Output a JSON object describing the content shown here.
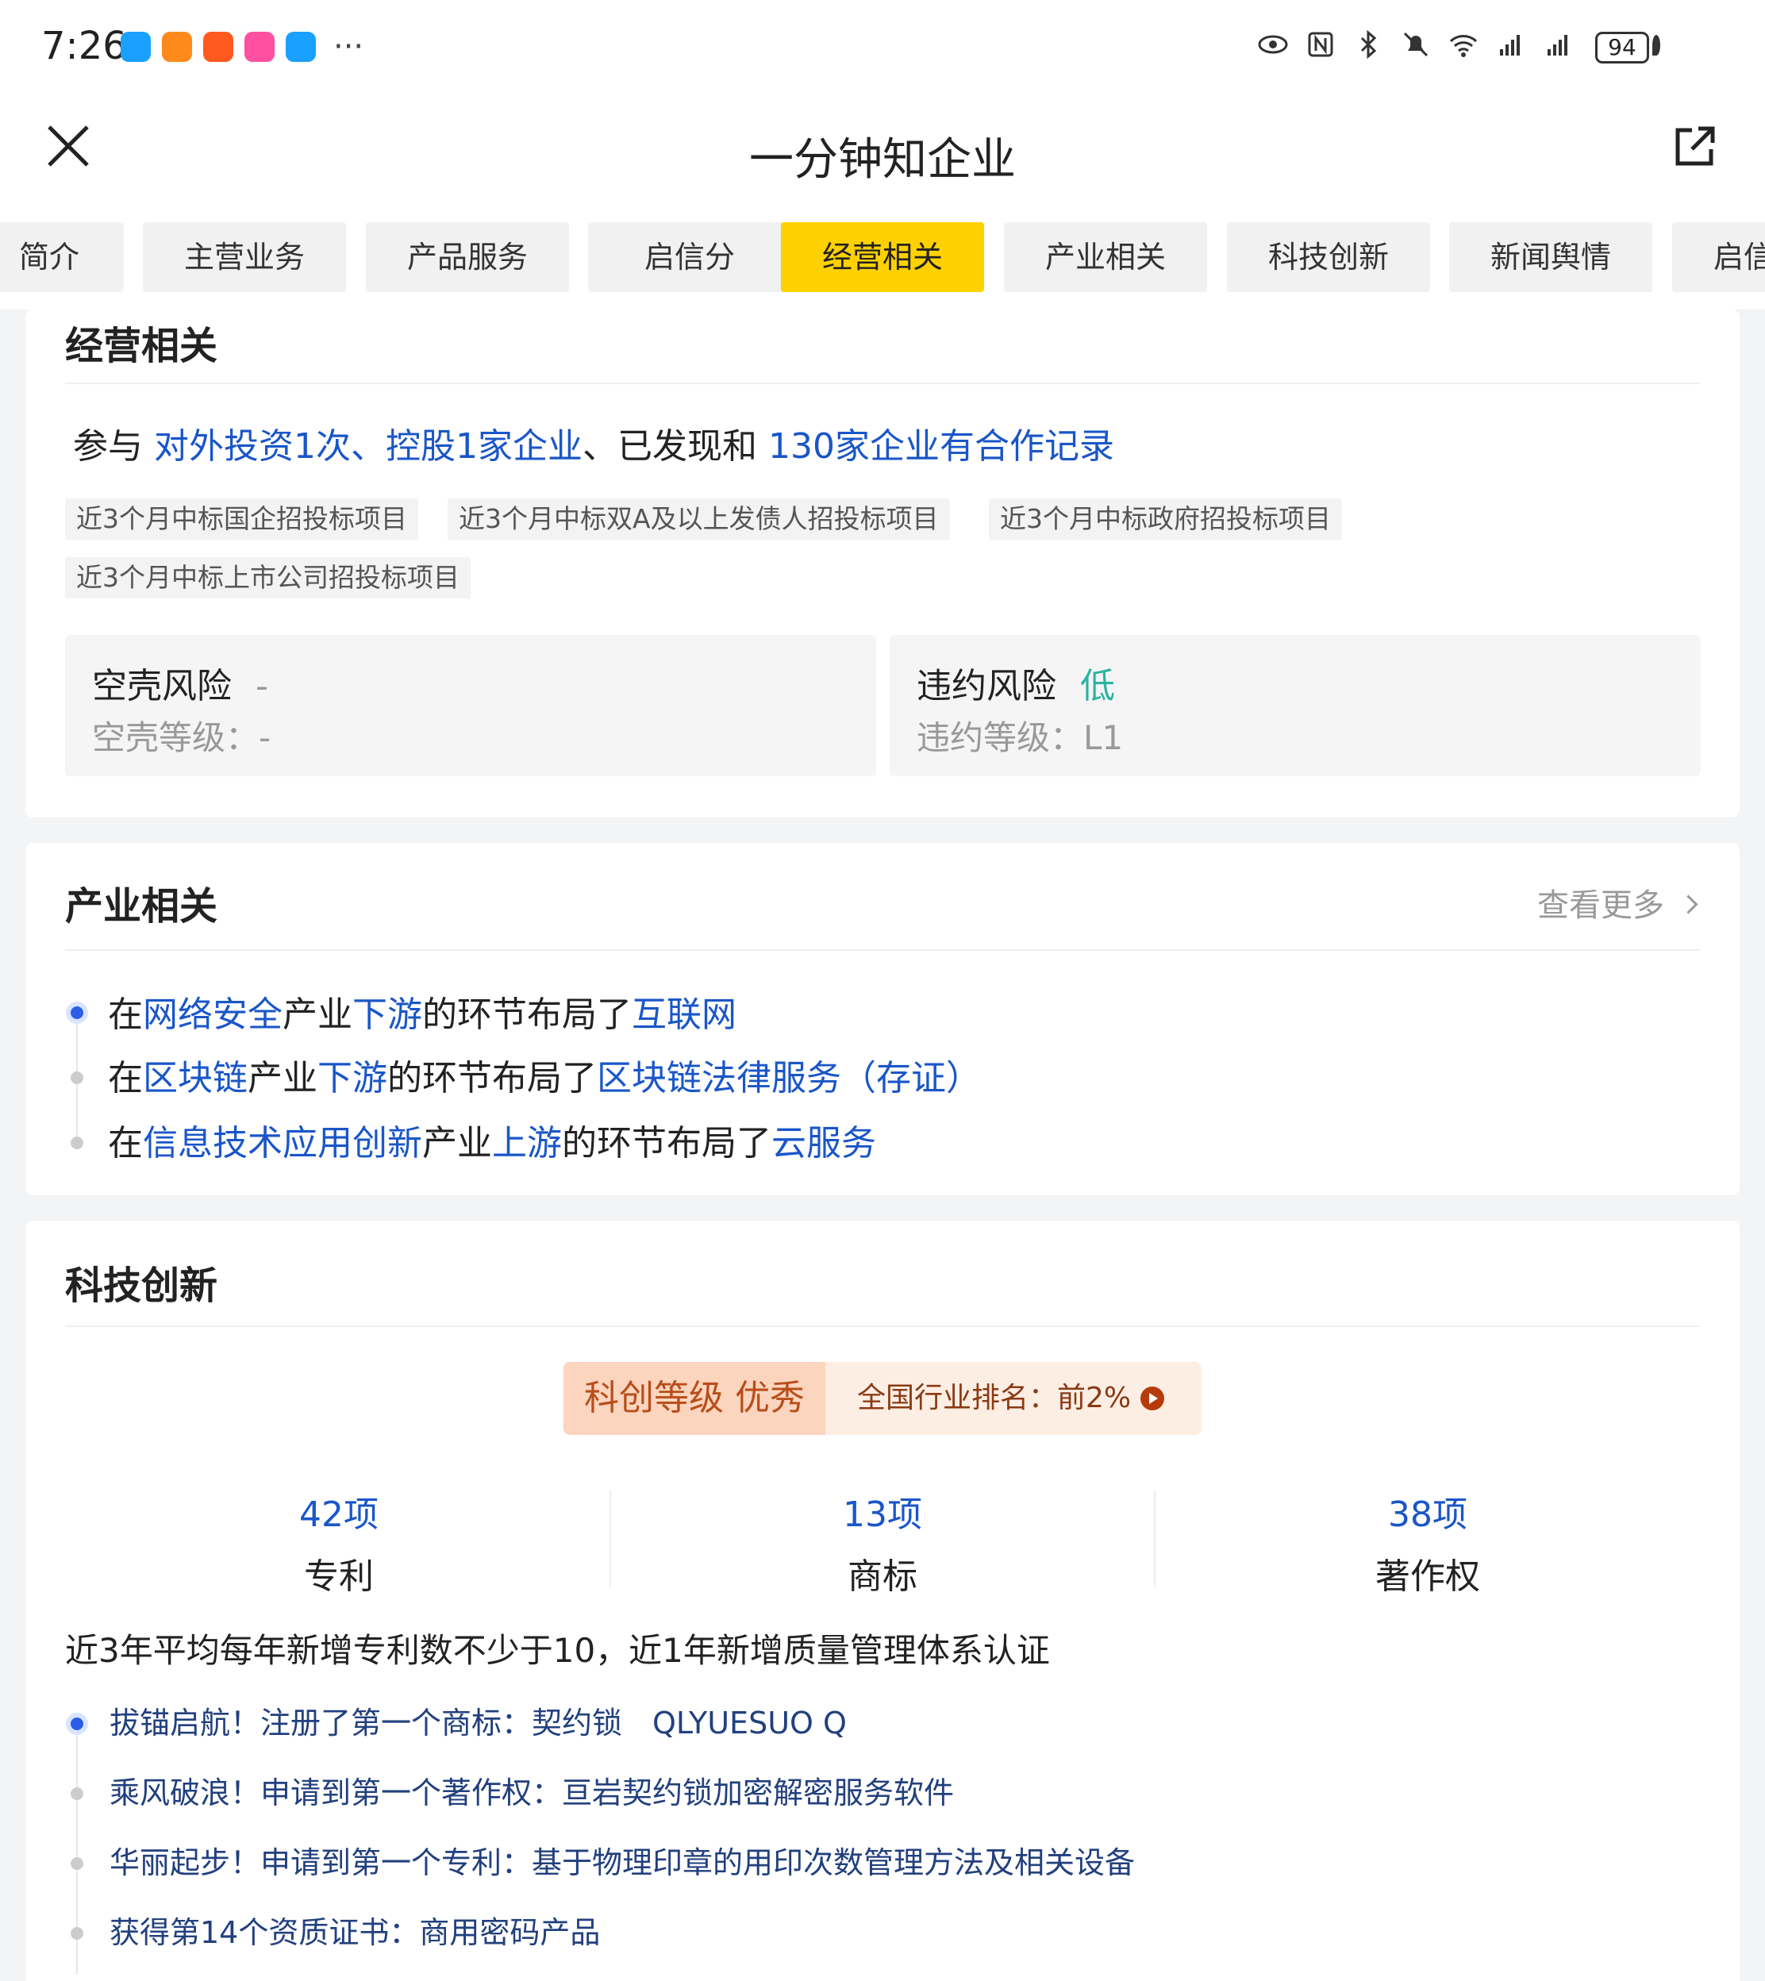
{
  "status_bar": {
    "time": "7:26",
    "more": "···",
    "battery": "94",
    "apps": [
      {
        "name": "cloud-app-icon",
        "color": "#1aa0ff"
      },
      {
        "name": "game-app-icon",
        "color": "#ff8a1c"
      },
      {
        "name": "taobao-app-icon",
        "color": "#ff5a1f"
      },
      {
        "name": "lala-app-icon",
        "color": "#ff4fa0"
      },
      {
        "name": "cloud-app-icon-2",
        "color": "#1aa0ff"
      }
    ]
  },
  "header": {
    "title": "一分钟知企业"
  },
  "tabs": [
    {
      "label": "简介"
    },
    {
      "label": "主营业务"
    },
    {
      "label": "产品服务"
    },
    {
      "label": "启信分"
    },
    {
      "label": "经营相关"
    },
    {
      "label": "产业相关"
    },
    {
      "label": "科技创新"
    },
    {
      "label": "新闻舆情"
    },
    {
      "label": "启信"
    }
  ],
  "active_tab": "经营相关",
  "operations": {
    "title": "经营相关",
    "summary": {
      "prefix": "参与 ",
      "link1": "对外投资1次、控股1家企业",
      "mid": "、已发现和 ",
      "link2": "130家企业有合作记录"
    },
    "tags": [
      "近3个月中标国企招投标项目",
      "近3个月中标双A及以上发债人招投标项目",
      "近3个月中标政府招投标项目",
      "近3个月中标上市公司招投标项目"
    ],
    "shell_risk": {
      "label": "空壳风险",
      "value": "-",
      "level_label": "空壳等级：",
      "level_value": "-"
    },
    "default_risk": {
      "label": "违约风险",
      "value": "低",
      "level_label": "违约等级：",
      "level_value": "L1"
    }
  },
  "industry": {
    "title": "产业相关",
    "more": "查看更多",
    "items": [
      {
        "p1": "在",
        "industry": "网络安全",
        "p2": "产业",
        "position": "下游",
        "p3": "的环节布局了",
        "segment": "互联网"
      },
      {
        "p1": "在",
        "industry": "区块链",
        "p2": "产业",
        "position": "下游",
        "p3": "的环节布局了",
        "segment": "区块链法律服务（存证）"
      },
      {
        "p1": "在",
        "industry": "信息技术应用创新",
        "p2": "产业",
        "position": "上游",
        "p3": "的环节布局了",
        "segment": "云服务"
      }
    ]
  },
  "tech": {
    "title": "科技创新",
    "grade_label": "科创等级 优秀",
    "ranking": "全国行业排名：前2%",
    "stats": [
      {
        "value": "42项",
        "label": "专利"
      },
      {
        "value": "13项",
        "label": "商标"
      },
      {
        "value": "38项",
        "label": "著作权"
      }
    ],
    "summary": "近3年平均每年新增专利数不少于10，近1年新增质量管理体系认证",
    "milestones": [
      "拔锚启航！注册了第一个商标：契约锁　QLYUESUO Q",
      "乘风破浪！申请到第一个著作权：亘岩契约锁加密解密服务软件",
      "华丽起步！申请到第一个专利：基于物理印章的用印次数管理方法及相关设备",
      "获得第14个资质证书：商用密码产品"
    ]
  },
  "colors": {
    "accent": "#ffd100",
    "link": "#1a56c8",
    "low_risk": "#2ab3a0"
  }
}
